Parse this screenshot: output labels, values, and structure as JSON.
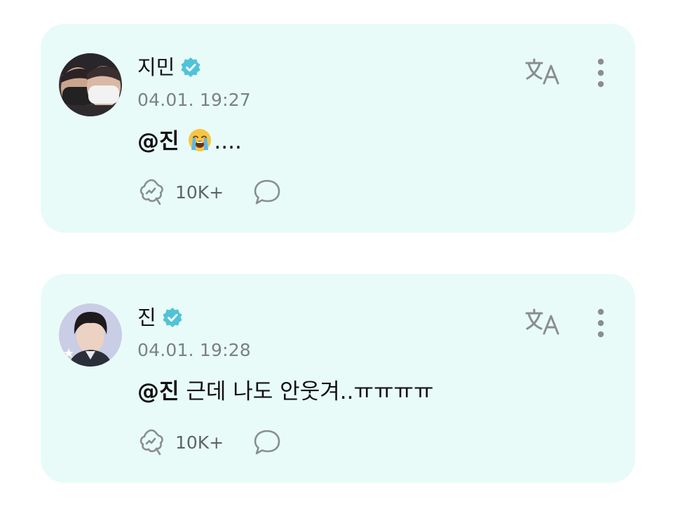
{
  "posts": [
    {
      "author": "지민",
      "avatar": "photo of two people wearing face masks",
      "verified": true,
      "timestamp": "04.01. 19:27",
      "mention": "@진",
      "emoji": "loudly-crying-face",
      "body_after_emoji": "....",
      "like_count": "10K+"
    },
    {
      "author": "진",
      "avatar": "portrait photo with star badge",
      "verified": true,
      "timestamp": "04.01. 19:28",
      "mention": "@진",
      "body": " 근데 나도 안웃겨..ㅠㅠㅠㅠ",
      "like_count": "10K+"
    }
  ],
  "colors": {
    "card_background": "#e8fbf8",
    "verified_badge": "#4fc3d9",
    "icon_gray": "#8a8d90"
  },
  "icons": {
    "verified": "verified-badge-icon",
    "translate": "translate-icon",
    "more": "more-vertical-icon",
    "like": "like-reaction-icon",
    "comment": "comment-bubble-icon"
  }
}
